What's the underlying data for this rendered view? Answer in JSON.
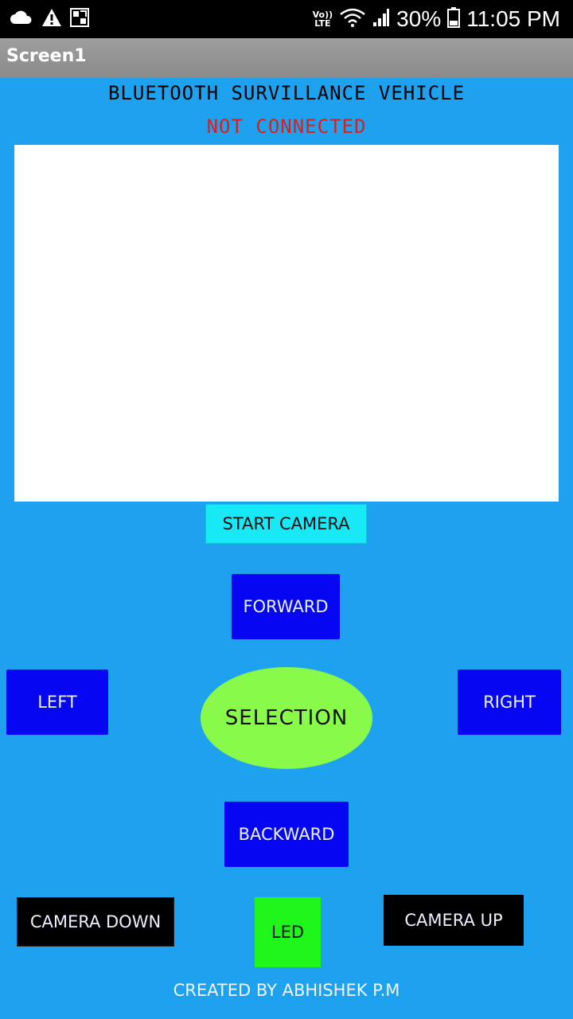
{
  "status_bar": {
    "left_icons": [
      "cloud-icon",
      "warning-icon",
      "gallery-icon"
    ],
    "volte_top": "Vo))",
    "volte_bottom": "LTE",
    "battery_percent": "30%",
    "time": "11:05 PM"
  },
  "titlebar": {
    "title": "Screen1"
  },
  "app": {
    "title": "BLUETOOTH SURVILLANCE VEHICLE",
    "connection_status": "NOT CONNECTED",
    "status_color": "#e21b1b"
  },
  "buttons": {
    "start_camera": "START CAMERA",
    "forward": "FORWARD",
    "left": "LEFT",
    "selection": "SELECTION",
    "right": "RIGHT",
    "backward": "BACKWARD",
    "camera_down": "CAMERA DOWN",
    "led": "LED",
    "camera_up": "CAMERA UP"
  },
  "footer": {
    "credit": "CREATED BY ABHISHEK P.M"
  },
  "colors": {
    "background": "#1ea1ee",
    "blue_button": "#0606f4",
    "selection": "#89fa4a",
    "led": "#1ff61b",
    "start_camera": "#17e9f6"
  }
}
